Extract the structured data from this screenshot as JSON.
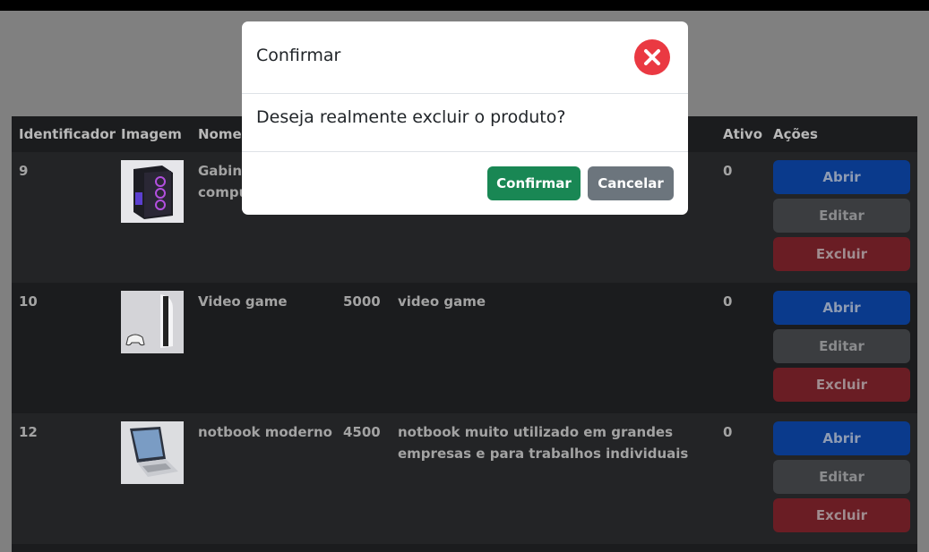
{
  "table": {
    "headers": [
      "Identificador",
      "Imagem",
      "Nome",
      "Ativo",
      "Ações"
    ],
    "rows": [
      {
        "id": "9",
        "name_line1": "Gabine",
        "name_line2": "compu",
        "price": "",
        "desc_line1": "",
        "desc_line2": "",
        "active": "0",
        "image_icon": "pc-case-image",
        "actions": {
          "open": "Abrir",
          "edit": "Editar",
          "delete": "Excluir"
        }
      },
      {
        "id": "10",
        "name_line1": "Video game",
        "name_line2": "",
        "price": "5000",
        "desc_line1": "video game",
        "desc_line2": "",
        "active": "0",
        "image_icon": "console-image",
        "actions": {
          "open": "Abrir",
          "edit": "Editar",
          "delete": "Excluir"
        }
      },
      {
        "id": "12",
        "name_line1": "notbook moderno",
        "name_line2": "",
        "price": "4500",
        "desc_line1": "notbook muito utilizado em grandes",
        "desc_line2": "empresas e para trabalhos individuais",
        "active": "0",
        "image_icon": "laptop-image",
        "actions": {
          "open": "Abrir",
          "edit": "Editar",
          "delete": "Excluir"
        }
      }
    ]
  },
  "modal": {
    "title": "Confirmar",
    "message": "Deseja realmente excluir o produto?",
    "confirm_label": "Confirmar",
    "cancel_label": "Cancelar",
    "close_icon": "close-icon"
  },
  "colors": {
    "overlay": "#808080",
    "table_bg": "#1b1c1e",
    "open_button": "#0a3a8c",
    "edit_button": "#3b3d40",
    "delete_button": "#6a1d24",
    "confirm_button": "#198754",
    "cancel_button": "#6c757d",
    "close_button": "#ea3942"
  }
}
